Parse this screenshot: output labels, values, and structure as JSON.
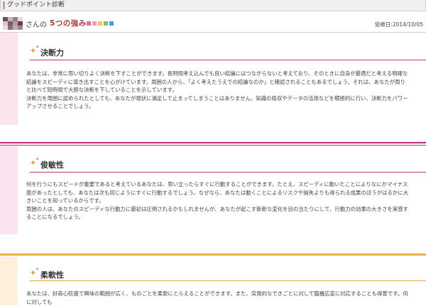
{
  "header": {
    "title": "グッドポイント診断"
  },
  "user": {
    "suffix": "さんの",
    "title": "5つの強み",
    "date": "受検日:2014/10/05",
    "square_colors": [
      "#e86aa0",
      "#f3a0b0",
      "#f6c05a",
      "#7cc36a",
      "#3aa5d0"
    ],
    "avatar_colors": [
      "#6b4c59",
      "#c8b4bf",
      "#9a7b8a",
      "#e5d9df",
      "#d8c4ce",
      "#7a5c69",
      "#b59aa8",
      "#5d4350",
      "#e9dde3",
      "#8d6f7c",
      "#c2a9b6",
      "#a48493"
    ]
  },
  "sections": [
    {
      "title": "決断力",
      "band_color": "#c8286e",
      "sidebar_color": "#fbe4ec",
      "hline_color": "#d4326f",
      "paragraphs": [
        "あなたは、非常に思い切りよく決断を下すことができます。長時間考え込んでも良い結論にはつながらないと考えており、そのときに自身が最適だと考える明確な結論をスピーディに導き出すことを心がけています。周囲の人から、「よく考えたうえでの結論なのか」と確認されることもあるでしょう。それは、あなたが周りと比べて短時間で大胆な決断を下していることを示しています。",
        "決断力を周囲に認められたとしても、あなたが現状に満足して止まってしまうことはありません。知識の吸収やデータの活用などを積極的に行い、決断力をパワーアップさせることでしょう。"
      ]
    },
    {
      "title": "俊敏性",
      "band_color": "#b8287a",
      "sidebar_color": "#fbe4ef",
      "hline_color": "#c2327f",
      "paragraphs": [
        "何を行うにもスピードが重要であると考えているあなたは、思い立ったらすぐに行動することができます。たとえ、スピーディに動いたことによりなにかマイナス面があったとしても、あなたは次も同じようにすぐに行動するでしょう。なぜなら、あなたは動くことによるリスクや損失よりも得られる成果のほうがはるかに大きいことを知っているからです。",
        "周囲の人は、あなたのスピーディな行動力に最初は圧倒されるかもしれませんが、あなたが起こす斬新な変化を目の当たりにして、行動力の効果の大きさを実感することになるでしょう。"
      ]
    },
    {
      "title": "柔軟性",
      "band_color": "#e8b040",
      "sidebar_color": "#fdf1dc",
      "hline_color": "#e2a83a",
      "paragraphs": [
        "あなたは、好奇心旺盛で興味の範囲が広く、ものごとを柔軟にとらえることができます。また、突発的なできごとに対して臨機応変に対応することも得意です。何に対しても"
      ]
    }
  ]
}
